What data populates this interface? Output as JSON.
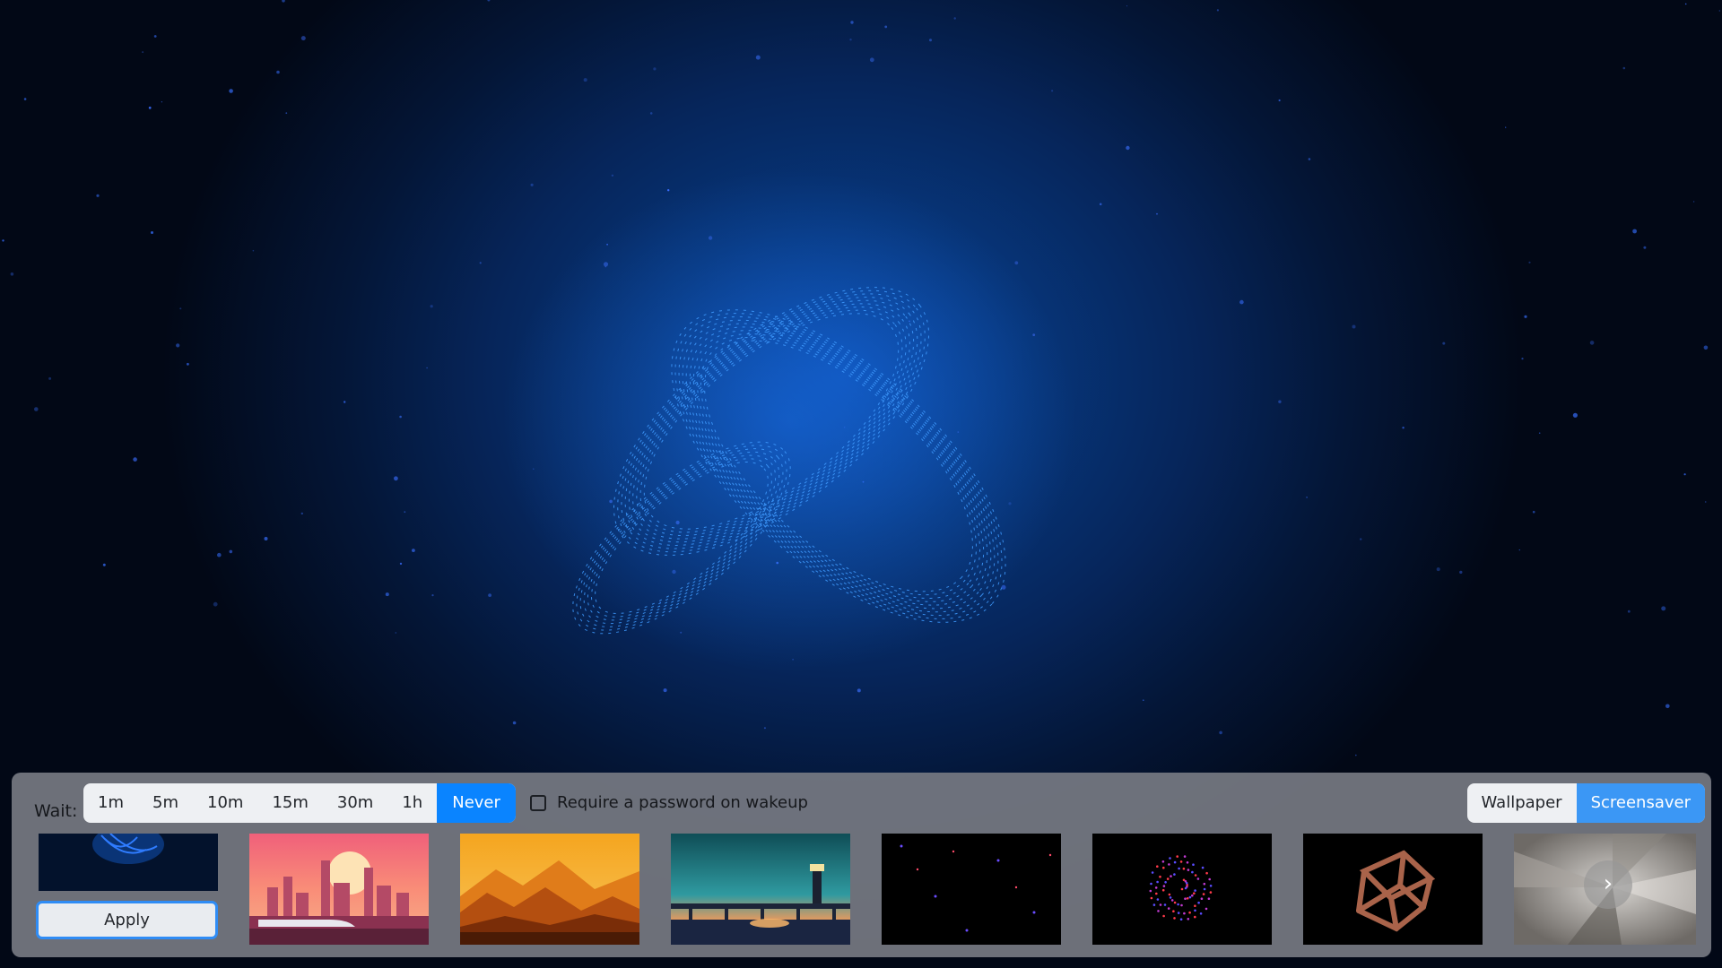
{
  "toolbar": {
    "wait_label": "Wait:",
    "wait_options": [
      "1m",
      "5m",
      "10m",
      "15m",
      "30m",
      "1h",
      "Never"
    ],
    "wait_selected": "Never",
    "password_label": "Require a password on wakeup",
    "password_checked": false,
    "mode_options": [
      "Wallpaper",
      "Screensaver"
    ],
    "mode_selected": "Screensaver",
    "apply_label": "Apply"
  },
  "icons": {
    "next": "chevron-right-icon",
    "next_glyph": "›"
  },
  "thumbnails": [
    {
      "name": "city-sunset-train"
    },
    {
      "name": "orange-mountains"
    },
    {
      "name": "lighthouse-bridge"
    },
    {
      "name": "dark-particles"
    },
    {
      "name": "particle-sphere"
    },
    {
      "name": "wireframe-cube"
    },
    {
      "name": "gray-spiral"
    }
  ],
  "colors": {
    "accent": "#0a84ff",
    "panel": "#767a82",
    "background": "#073579"
  }
}
